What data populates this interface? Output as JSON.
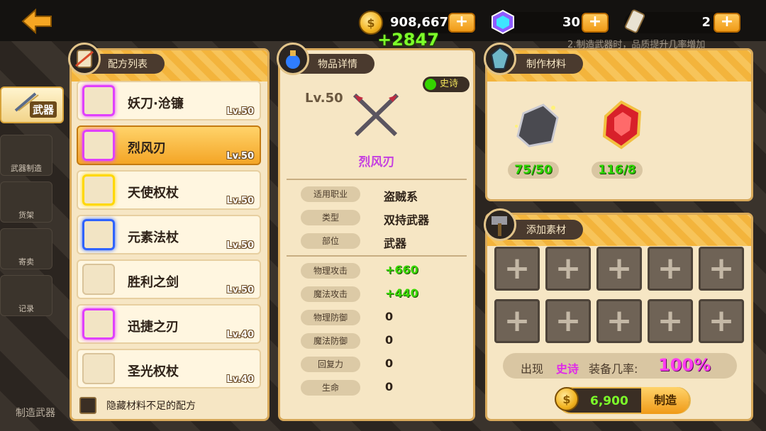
{
  "topbar": {
    "gold": "908,667",
    "gold_gain": "+2847",
    "gem_count": "30",
    "ticket_count": "2",
    "plus_label": "+",
    "notice_text": "2.制造武器时，品质提升几率增加"
  },
  "sidebar": {
    "items": [
      {
        "label": "武器",
        "active": true
      },
      {
        "label": "武器制造"
      },
      {
        "label": "货架"
      },
      {
        "label": "寄卖"
      },
      {
        "label": "记录"
      }
    ]
  },
  "recipes": {
    "title": "配方列表",
    "items": [
      {
        "name": "妖刀·沧镰",
        "level": "Lv.50",
        "rarity": "purple"
      },
      {
        "name": "烈风刃",
        "level": "Lv.50",
        "rarity": "purple",
        "selected": true
      },
      {
        "name": "天使权杖",
        "level": "Lv.50",
        "rarity": "yellow"
      },
      {
        "name": "元素法杖",
        "level": "Lv.50",
        "rarity": "blue"
      },
      {
        "name": "胜利之剑",
        "level": "Lv.50",
        "rarity": "none"
      },
      {
        "name": "迅捷之刃",
        "level": "Lv.40",
        "rarity": "purple"
      },
      {
        "name": "圣光权杖",
        "level": "Lv.40",
        "rarity": "none"
      }
    ],
    "hide_label": "隐藏材料不足的配方",
    "footer_text": "制造武器"
  },
  "detail": {
    "title": "物品详情",
    "level": "Lv.50",
    "quality": "史诗",
    "item_name": "烈风刃",
    "attrs": [
      {
        "label": "适用职业",
        "value": "盗贼系"
      },
      {
        "label": "类型",
        "value": "双持武器"
      },
      {
        "label": "部位",
        "value": "武器"
      }
    ],
    "stats": [
      {
        "label": "物理攻击",
        "value": "+660",
        "green": true
      },
      {
        "label": "魔法攻击",
        "value": "+440",
        "green": true
      },
      {
        "label": "物理防御",
        "value": "0"
      },
      {
        "label": "魔法防御",
        "value": "0"
      },
      {
        "label": "回复力",
        "value": "0"
      },
      {
        "label": "生命",
        "value": "0"
      }
    ]
  },
  "materials": {
    "title": "制作材料",
    "items": [
      {
        "icon": "ore-icon",
        "count": "75/50"
      },
      {
        "icon": "ruby-icon",
        "count": "116/8"
      }
    ]
  },
  "addon": {
    "title": "添加素材",
    "slot_count": 10,
    "rate_prefix": "出现",
    "rate_quality": "史诗",
    "rate_middle": "装备几率:",
    "rate_value": "100%"
  },
  "craft": {
    "cost": "6,900",
    "label": "制造"
  }
}
